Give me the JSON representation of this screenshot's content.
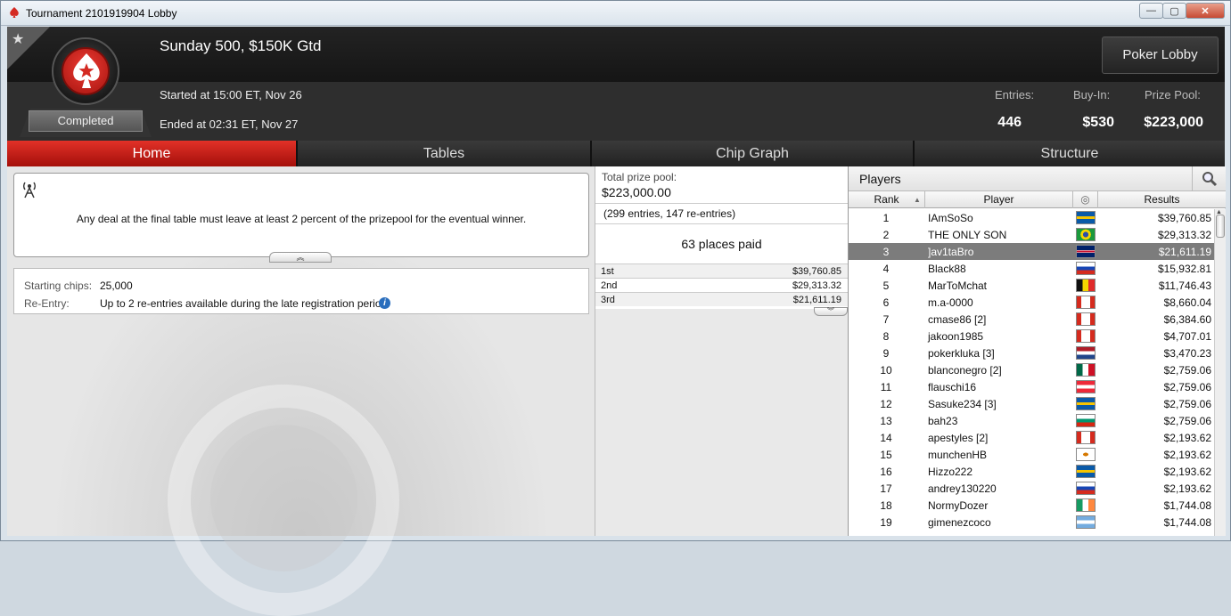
{
  "window": {
    "title": "Tournament 2101919904 Lobby",
    "min_label": "—",
    "max_label": "▢",
    "close_label": "✕"
  },
  "header": {
    "status": "Completed",
    "name": "Sunday 500, $150K Gtd",
    "started": "Started at 15:00 ET, Nov 26",
    "ended": "Ended at 02:31 ET, Nov 27",
    "lobby_button": "Poker Lobby",
    "entries_label": "Entries:",
    "entries_value": "446",
    "buyin_label": "Buy-In:",
    "buyin_value": "$530",
    "prize_label": "Prize Pool:",
    "prize_value": "$223,000"
  },
  "tabs": [
    {
      "label": "Home"
    },
    {
      "label": "Tables"
    },
    {
      "label": "Chip Graph"
    },
    {
      "label": "Structure"
    }
  ],
  "notice": {
    "text": "Any deal at the final table must leave at least 2 percent of the prizepool for the eventual winner.",
    "expander": "︽"
  },
  "info": {
    "starting_chips_label": "Starting chips:",
    "starting_chips_value": "25,000",
    "reentry_label": "Re-Entry:",
    "reentry_value": "Up to 2 re-entries available during the late registration period.",
    "info_icon": "i"
  },
  "prize": {
    "total_label": "Total prize pool:",
    "total_value": "$223,000.00",
    "entries": "(299 entries, 147 re-entries)",
    "places": "63 places paid",
    "payouts": [
      {
        "place": "1st",
        "amount": "$39,760.85"
      },
      {
        "place": "2nd",
        "amount": "$29,313.32"
      },
      {
        "place": "3rd",
        "amount": "$21,611.19"
      }
    ],
    "expander": "︾"
  },
  "players": {
    "title": "Players",
    "col_rank": "Rank",
    "col_player": "Player",
    "col_results": "Results",
    "rows": [
      {
        "rank": "1",
        "name": "IAmSoSo",
        "result": "$39,760.85",
        "flag": "sweden"
      },
      {
        "rank": "2",
        "name": "THE ONLY SON",
        "result": "$29,313.32",
        "flag": "brazil"
      },
      {
        "rank": "3",
        "name": "]av1taBro",
        "result": "$21,611.19",
        "flag": "uk"
      },
      {
        "rank": "4",
        "name": "Black88",
        "result": "$15,932.81",
        "flag": "russia"
      },
      {
        "rank": "5",
        "name": "MarToMchat",
        "result": "$11,746.43",
        "flag": "belgium"
      },
      {
        "rank": "6",
        "name": "m.a-0000",
        "result": "$8,660.04",
        "flag": "canada"
      },
      {
        "rank": "7",
        "name": "cmase86 [2]",
        "result": "$6,384.60",
        "flag": "canada"
      },
      {
        "rank": "8",
        "name": "jakoon1985",
        "result": "$4,707.01",
        "flag": "canada"
      },
      {
        "rank": "9",
        "name": "pokerkluka [3]",
        "result": "$3,470.23",
        "flag": "netherlands"
      },
      {
        "rank": "10",
        "name": "blanconegro [2]",
        "result": "$2,759.06",
        "flag": "mexico"
      },
      {
        "rank": "11",
        "name": "flauschi16",
        "result": "$2,759.06",
        "flag": "austria"
      },
      {
        "rank": "12",
        "name": "Sasuke234 [3]",
        "result": "$2,759.06",
        "flag": "sweden"
      },
      {
        "rank": "13",
        "name": "bah23",
        "result": "$2,759.06",
        "flag": "bulgaria"
      },
      {
        "rank": "14",
        "name": "apestyles [2]",
        "result": "$2,193.62",
        "flag": "canada"
      },
      {
        "rank": "15",
        "name": "munchenHB",
        "result": "$2,193.62",
        "flag": "cyprus"
      },
      {
        "rank": "16",
        "name": "Hizzo222",
        "result": "$2,193.62",
        "flag": "sweden"
      },
      {
        "rank": "17",
        "name": "andrey130220",
        "result": "$2,193.62",
        "flag": "russia"
      },
      {
        "rank": "18",
        "name": "NormyDozer",
        "result": "$1,744.08",
        "flag": "ireland"
      },
      {
        "rank": "19",
        "name": "gimenezcoco",
        "result": "$1,744.08",
        "flag": "argentina"
      }
    ],
    "selected_rank": "3"
  },
  "colors": {
    "accent_red": "#d42a22",
    "selected_row": "#7c7c7c"
  }
}
